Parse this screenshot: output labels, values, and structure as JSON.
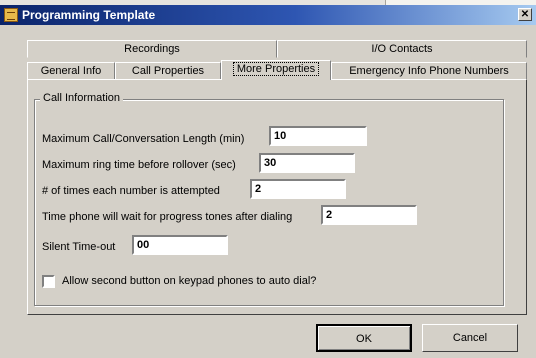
{
  "window": {
    "title": "Programming Template",
    "close_glyph": "✕",
    "icon": "app-template-icon"
  },
  "tabs": {
    "row1": [
      "Recordings",
      "I/O Contacts"
    ],
    "row2": [
      "General Info",
      "Call Properties",
      "More Properties",
      "Emergency Info Phone Numbers"
    ],
    "active": "More Properties"
  },
  "group": {
    "label": "Call Information",
    "fields": [
      {
        "label": "Maximum Call/Conversation Length (min)",
        "value": "10"
      },
      {
        "label": "Maximum ring time before rollover (sec)",
        "value": "30"
      },
      {
        "label": "# of times each number is attempted",
        "value": "2"
      },
      {
        "label": "Time phone will wait for progress tones after dialing",
        "value": "2"
      },
      {
        "label": "Silent Time-out",
        "value": "00"
      }
    ],
    "checkbox": {
      "label": "Allow second button on keypad phones to auto dial?",
      "checked": false
    }
  },
  "buttons": {
    "ok": "OK",
    "cancel": "Cancel"
  }
}
